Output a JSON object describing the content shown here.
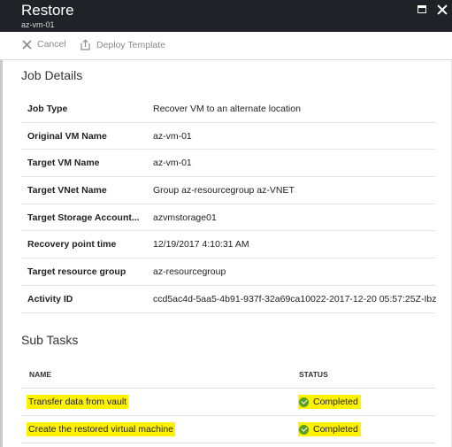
{
  "window": {
    "title": "Restore",
    "subtitle": "az-vm-01"
  },
  "toolbar": {
    "cancel_label": "Cancel",
    "deploy_label": "Deploy Template"
  },
  "job_details": {
    "title": "Job Details",
    "rows": [
      {
        "key": "Job Type",
        "value": "Recover VM to an alternate location"
      },
      {
        "key": "Original VM Name",
        "value": "az-vm-01"
      },
      {
        "key": "Target VM Name",
        "value": "az-vm-01"
      },
      {
        "key": "Target VNet Name",
        "value": "Group az-resourcegroup az-VNET"
      },
      {
        "key": "Target Storage Account...",
        "value": "azvmstorage01"
      },
      {
        "key": "Recovery point time",
        "value": "12/19/2017 4:10:31 AM"
      },
      {
        "key": "Target resource group",
        "value": "az-resourcegroup"
      },
      {
        "key": "Activity ID",
        "value": "ccd5ac4d-5aa5-4b91-937f-32a69ca10022-2017-12-20 05:57:25Z-Ibz"
      }
    ]
  },
  "sub_tasks": {
    "title": "Sub Tasks",
    "headers": {
      "name": "NAME",
      "status": "STATUS"
    },
    "rows": [
      {
        "name": "Transfer data from vault",
        "status": "Completed"
      },
      {
        "name": "Create the restored virtual machine",
        "status": "Completed"
      }
    ]
  },
  "colors": {
    "titlebar": "#1f2328",
    "highlight": "#fff200",
    "success": "#5a9e1f"
  },
  "icons": {
    "cancel": "x-icon",
    "deploy": "export-icon",
    "maximize": "maximize-icon",
    "close": "close-icon",
    "status": "check-circle-icon"
  }
}
